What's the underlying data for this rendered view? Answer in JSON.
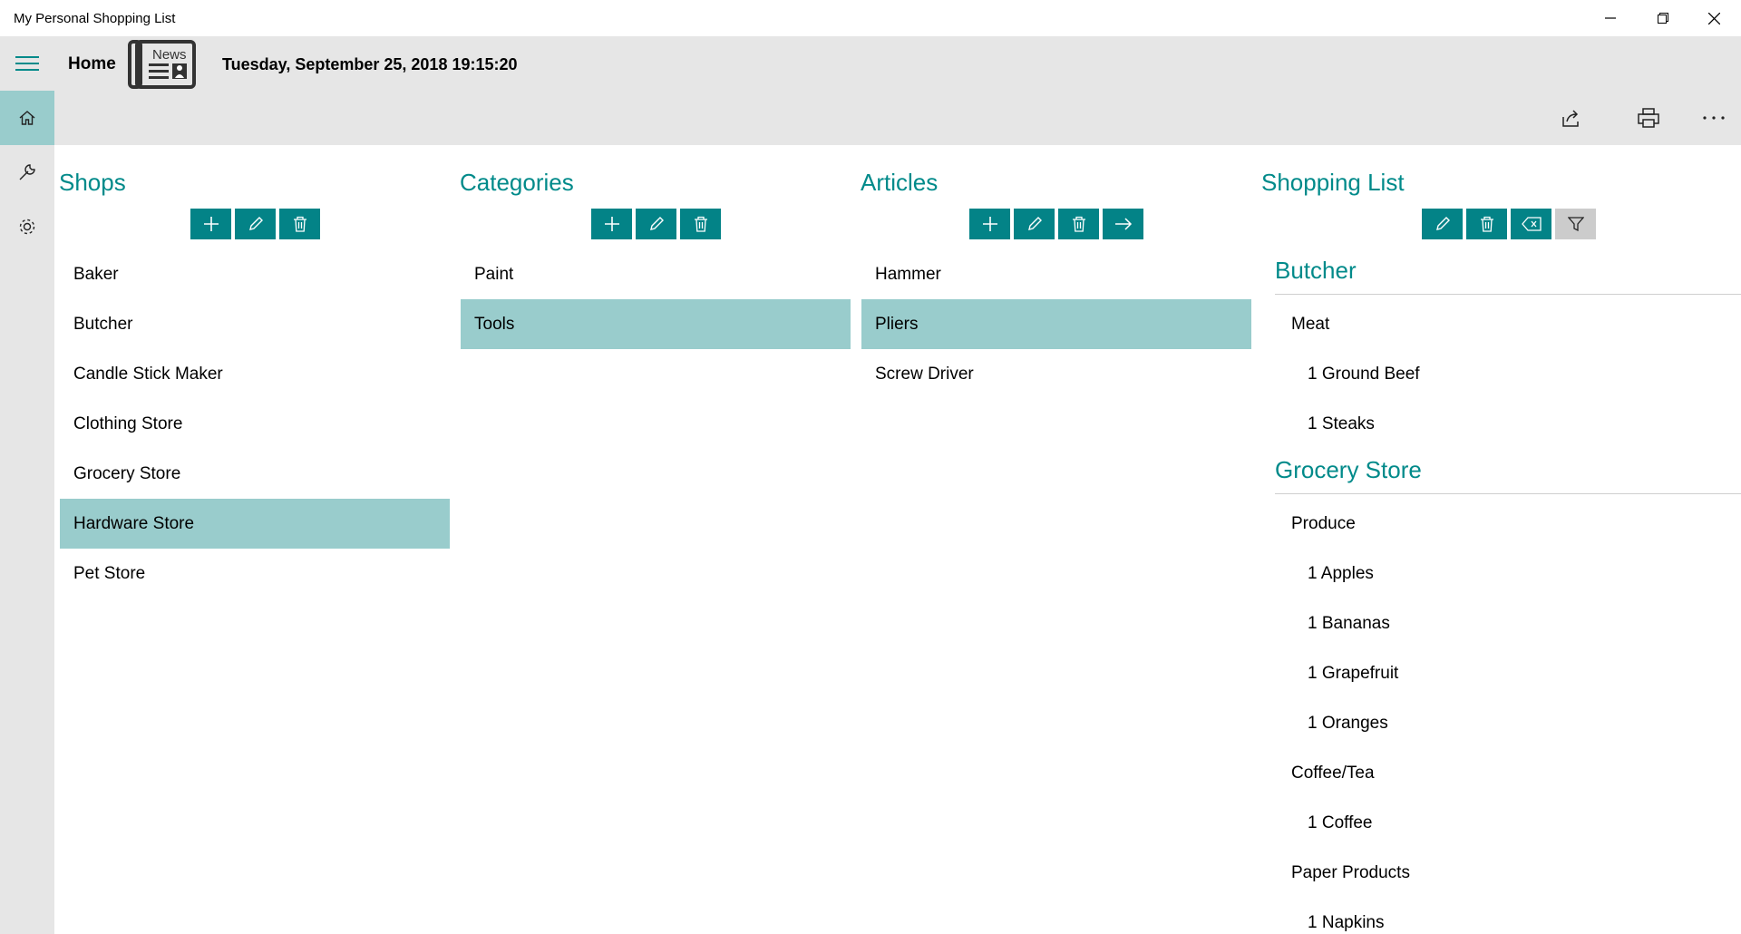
{
  "window": {
    "title": "My Personal Shopping List"
  },
  "header": {
    "home_label": "Home",
    "news_logo_text": "News",
    "datetime": "Tuesday, September 25, 2018 19:15:20"
  },
  "rail": {
    "items": [
      "home-icon",
      "wrench-icon",
      "gear-icon"
    ],
    "active_index": 0
  },
  "toolbar": {
    "icons": [
      "share-icon",
      "print-icon",
      "more-icon"
    ]
  },
  "colors": {
    "accent": "#008a8a",
    "button": "#038387",
    "selection": "#99cccc",
    "chrome": "#e6e6e6"
  },
  "shops": {
    "title": "Shops",
    "items": [
      "Baker",
      "Butcher",
      "Candle Stick Maker",
      "Clothing Store",
      "Grocery Store",
      "Hardware Store",
      "Pet Store"
    ],
    "selected": "Hardware Store"
  },
  "categories": {
    "title": "Categories",
    "items": [
      "Paint",
      "Tools"
    ],
    "selected": "Tools"
  },
  "articles": {
    "title": "Articles",
    "items": [
      "Hammer",
      "Pliers",
      "Screw Driver"
    ],
    "selected": "Pliers"
  },
  "shopping_list": {
    "title": "Shopping List",
    "rows": [
      {
        "kind": "shop",
        "text": "Butcher"
      },
      {
        "kind": "cat",
        "text": "Meat"
      },
      {
        "kind": "art",
        "text": "1 Ground Beef"
      },
      {
        "kind": "art",
        "text": "1 Steaks"
      },
      {
        "kind": "shop",
        "text": "Grocery Store"
      },
      {
        "kind": "cat",
        "text": "Produce"
      },
      {
        "kind": "art",
        "text": "1 Apples"
      },
      {
        "kind": "art",
        "text": "1 Bananas"
      },
      {
        "kind": "art",
        "text": "1 Grapefruit"
      },
      {
        "kind": "art",
        "text": "1 Oranges"
      },
      {
        "kind": "cat",
        "text": "Coffee/Tea"
      },
      {
        "kind": "art",
        "text": "1 Coffee"
      },
      {
        "kind": "cat",
        "text": "Paper Products"
      },
      {
        "kind": "art",
        "text": "1 Napkins"
      }
    ]
  }
}
